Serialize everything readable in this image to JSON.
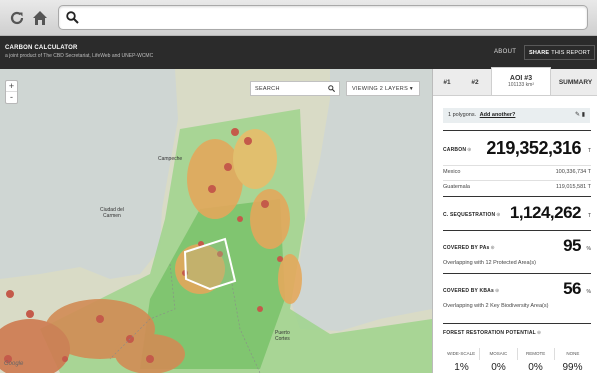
{
  "browser": {
    "refresh_icon": "refresh-icon",
    "home_icon": "home-icon",
    "search_icon": "search-icon",
    "url_value": ""
  },
  "header": {
    "title": "CARBON CALCULATOR",
    "subtitle": "a joint product of The CBD Secretariat, LifeWeb and UNEP-WCMC",
    "about": "ABOUT",
    "share_bold": "SHARE",
    "share_rest": "THIS REPORT"
  },
  "map": {
    "zoom_in": "+",
    "zoom_out": "-",
    "search_label": "SEARCH",
    "layers_label": "VIEWING 2 LAYERS",
    "labels": {
      "campeche": "Campeche",
      "ciudad_del_carmen": "Ciudad del\nCarmen",
      "puerto_cortes": "Puerto\nCortes"
    },
    "google": "Google",
    "colors": {
      "low": "#7fc97a",
      "mid": "#e8b865",
      "high": "#c45a4a",
      "polygon": "#ffffff"
    }
  },
  "panel": {
    "tabs": [
      {
        "label": "#1"
      },
      {
        "label": "#2"
      },
      {
        "label": "AOI #3",
        "sub": "101133 km²"
      },
      {
        "label": "SUMMARY"
      }
    ],
    "polygons_text": "1 polygons.",
    "add_another": "Add another?",
    "tools": "✎ ▮",
    "carbon": {
      "label": "CARBON",
      "value": "219,352,316",
      "unit": "T",
      "rows": [
        {
          "name": "Mexico",
          "value": "100,336,734 T"
        },
        {
          "name": "Guatemala",
          "value": "119,015,581 T"
        }
      ]
    },
    "sequestration": {
      "label": "C. SEQUESTRATION",
      "value": "1,124,262",
      "unit": "T"
    },
    "pas": {
      "label": "COVERED BY PAs",
      "value": "95",
      "unit": "%",
      "note": "Overlapping with 12 Protected Area(s)"
    },
    "kbas": {
      "label": "COVERED BY KBAs",
      "value": "56",
      "unit": "%",
      "note": "Overlapping with 2 Key Biodiversity Area(s)"
    },
    "forest": {
      "label": "FOREST RESTORATION POTENTIAL",
      "columns": [
        "WIDE-SCALE",
        "MOSAIC",
        "REMOTE",
        "NONE"
      ],
      "values": [
        "1%",
        "0%",
        "0%",
        "99%"
      ]
    }
  }
}
